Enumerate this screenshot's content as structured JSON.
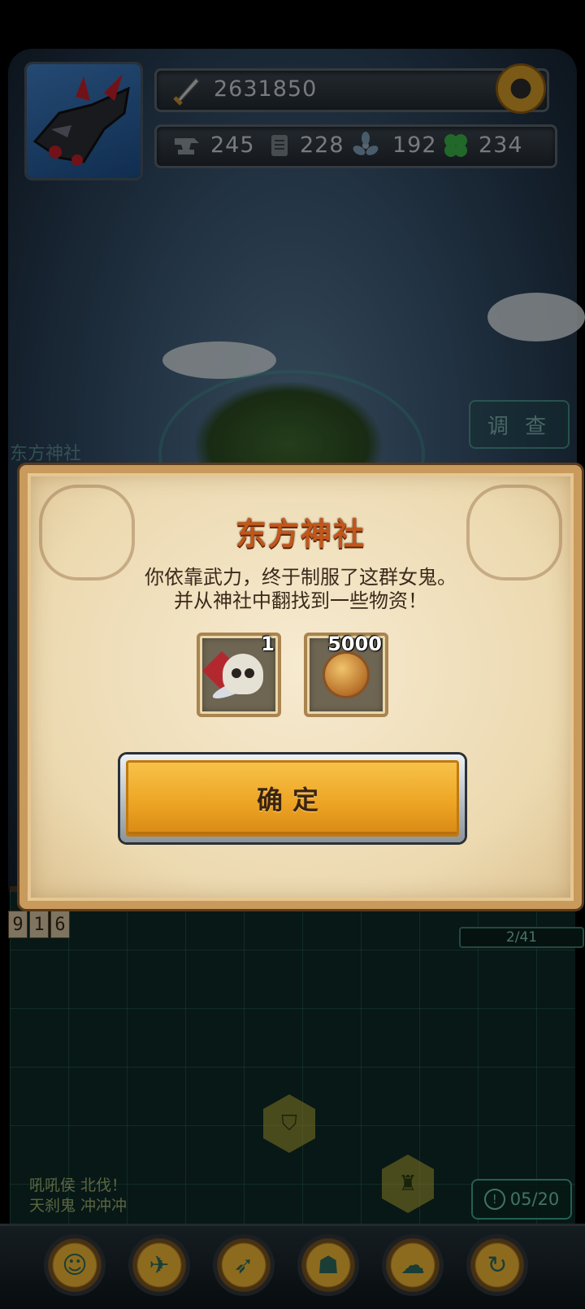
{
  "hud": {
    "power": "2631850",
    "resources": [
      {
        "icon": "anvil-icon",
        "value": "245"
      },
      {
        "icon": "scroll-icon",
        "value": "228"
      },
      {
        "icon": "fan-icon",
        "value": "192"
      },
      {
        "icon": "clover-icon",
        "value": "234"
      }
    ]
  },
  "background": {
    "location_label": "东方神社",
    "survey_label": "调 查",
    "counter": [
      "9",
      "1",
      "6"
    ],
    "progress_text": "2/41",
    "hex_buttons": [
      {
        "icon": "shield-banner-icon",
        "glyph": "⛉"
      },
      {
        "icon": "castle-icon",
        "glyph": "♜"
      }
    ],
    "chat_lines": [
      "吼吼侯  北伐！",
      "天刹鬼  冲冲冲"
    ],
    "quest_counter": "05/20",
    "quest_icon_glyph": "!"
  },
  "dock": [
    {
      "icon": "pet-icon",
      "glyph": "☺"
    },
    {
      "icon": "airship-icon",
      "glyph": "✈"
    },
    {
      "icon": "rocket-icon",
      "glyph": "➶"
    },
    {
      "icon": "bag-icon",
      "glyph": "☗"
    },
    {
      "icon": "cloud-creature-icon",
      "glyph": "☁"
    },
    {
      "icon": "refresh-icon",
      "glyph": "↻"
    }
  ],
  "modal": {
    "title": "东方神社",
    "message_line1": "你依靠武力，终于制服了这群女鬼。",
    "message_line2": "并从神社中翻找到一些物资！",
    "rewards": [
      {
        "icon": "skull-relic-icon",
        "quantity": "1"
      },
      {
        "icon": "copper-coin-icon",
        "quantity": "5000"
      }
    ],
    "confirm_label": "确定"
  },
  "colors": {
    "modal_title": "#c2561b",
    "confirm_button": "#eea524",
    "parchment": "#ecd9b0"
  }
}
